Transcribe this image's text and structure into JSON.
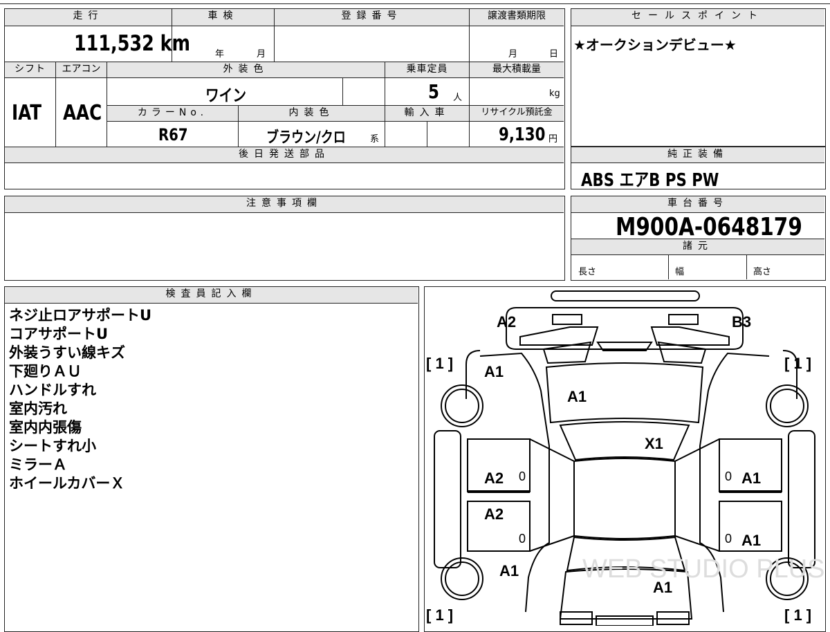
{
  "header": {
    "mileage_label": "走行",
    "inspection_label": "車検",
    "registration_label": "登録番号",
    "transfer_deadline_label": "譲渡書類期限",
    "sales_point_label": "セールスポイント"
  },
  "vehicle": {
    "mileage": "111,532",
    "mileage_unit": "km",
    "inspection_year_unit": "年",
    "inspection_month_unit": "月",
    "deadline_month_unit": "月",
    "deadline_day_unit": "日",
    "shift_label": "シフト",
    "shift": "IAT",
    "ac_label": "エアコン",
    "ac": "AAC",
    "exterior_color_label": "外装色",
    "exterior_color": "ワイン",
    "capacity_label": "乗車定員",
    "capacity": "5",
    "capacity_unit": "人",
    "max_load_label": "最大積載量",
    "max_load_unit": "kg",
    "color_no_label": "カラーNo.",
    "color_no": "R67",
    "interior_color_label": "内装色",
    "interior_color": "ブラウン/クロ",
    "interior_suffix": "系",
    "import_label": "輸入車",
    "recycle_label": "リサイクル預託金",
    "recycle_fee": "9,130",
    "recycle_unit": "円"
  },
  "sales_point": "★オークションデビュー★",
  "later_parts_label": "後日発送部品",
  "equipment": {
    "label": "純正装備",
    "items": "ABS エアB PS PW"
  },
  "caution_label": "注意事項欄",
  "chassis": {
    "label": "車台番号",
    "number": "M900A-0648179"
  },
  "specs": {
    "label": "諸元",
    "length": "長さ",
    "width": "幅",
    "height": "高さ"
  },
  "inspector": {
    "label": "検査員記入欄",
    "notes": [
      "ネジ止ロアサポートU",
      "コアサポートU",
      "外装うすい線キズ",
      "下廻りＡＵ",
      "ハンドルすれ",
      "室内汚れ",
      "室内内張傷",
      "シートすれ小",
      "ミラーＡ",
      "ホイールカバーＸ"
    ]
  },
  "diagram": {
    "marks": {
      "front_left_corner": "A2",
      "front_right_corner": "B3",
      "hood_left": "A1",
      "hood": "A1",
      "windshield": "X1",
      "front_left_door": "A2",
      "rear_left_door": "A2",
      "front_right_door": "A1",
      "rear_right_door": "A1",
      "rear_left": "A1",
      "rear": "A1",
      "tire_fl": "[ 1 ]",
      "tire_fr": "[ 1 ]",
      "tire_rl": "[ 1 ]",
      "tire_rr": "[ 1 ]",
      "zero_1": "0",
      "zero_2": "0",
      "zero_3": "0",
      "zero_4": "0"
    },
    "watermark": "WEB STUDIO PLUS"
  }
}
